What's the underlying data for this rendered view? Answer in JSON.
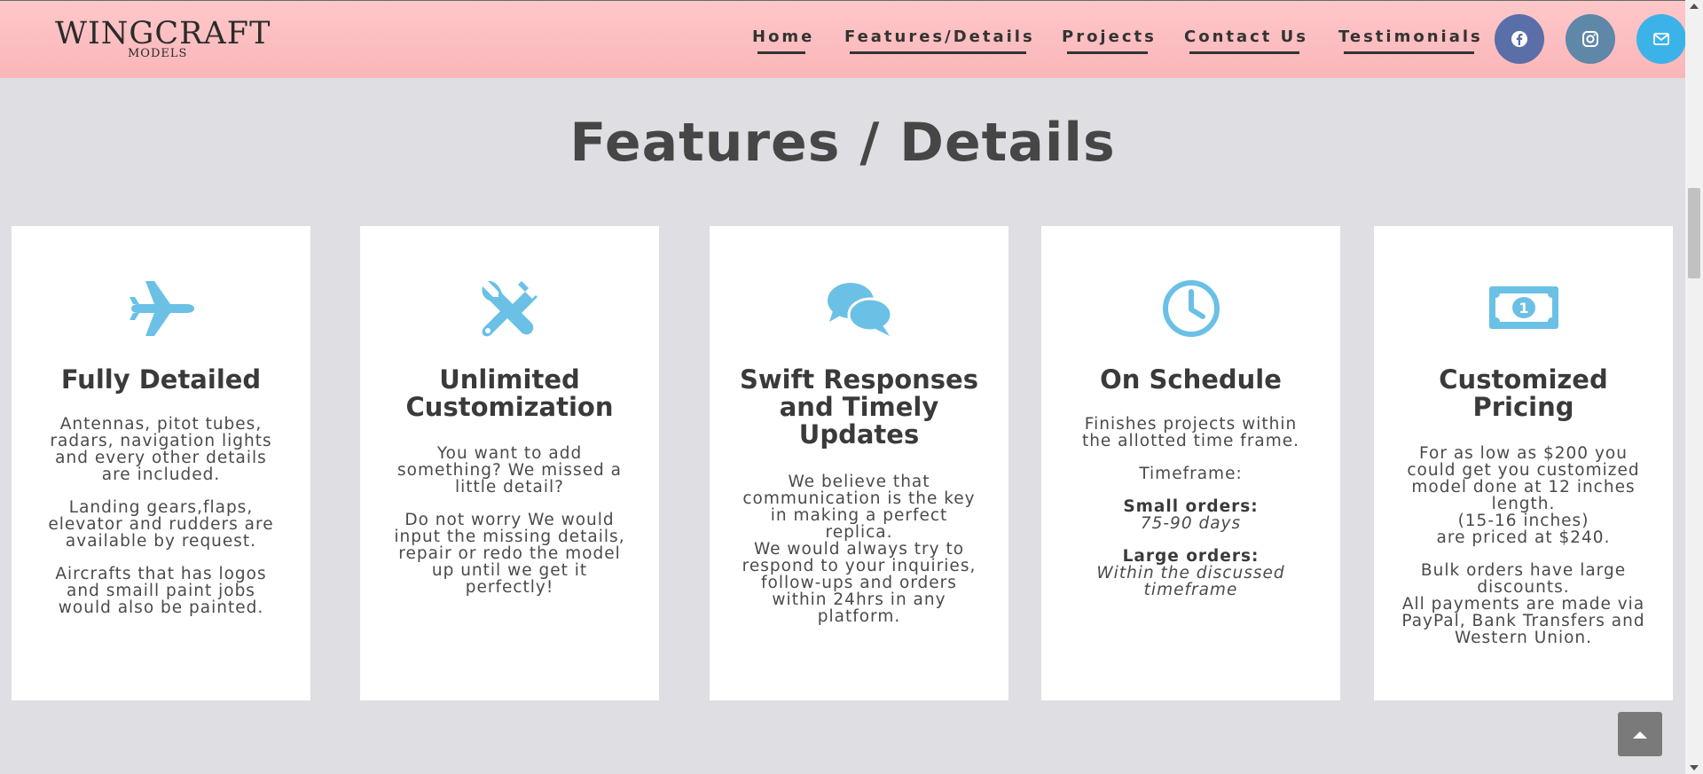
{
  "header": {
    "logo_main": "WINGCRAFT",
    "logo_sub": "MODELS",
    "nav": [
      {
        "label": "Home"
      },
      {
        "label": "Features/Details"
      },
      {
        "label": "Projects"
      },
      {
        "label": "Contact Us"
      },
      {
        "label": "Testimonials"
      }
    ],
    "social": [
      {
        "icon": "facebook-icon",
        "color": "#5a6ea8"
      },
      {
        "icon": "instagram-icon",
        "color": "#5f87a8"
      },
      {
        "icon": "mail-icon",
        "color": "#3bb3e8"
      }
    ]
  },
  "main": {
    "title": "Features / Details",
    "accent_color": "#6bc0e6",
    "cards": [
      {
        "icon": "airplane-icon",
        "title": "Fully Detailed",
        "p1": "Antennas, pitot tubes, radars, navigation lights and every other details are included.",
        "p2": "Landing gears,flaps, elevator and rudders are available by request.",
        "p3": "Aircrafts that has logos and smaill paint jobs would also be painted."
      },
      {
        "icon": "tools-icon",
        "title": "Unlimited Customization",
        "p1": "You want to add something? We missed a little detail?",
        "p2": "Do not worry We would input the missing details, repair or redo the model up until we get it perfectly!"
      },
      {
        "icon": "chat-icon",
        "title": "Swift Responses and Timely Updates",
        "p1": "We believe that communication is the key in making a perfect replica.",
        "p2": "We would always try to respond to your inquiries, follow-ups and orders within 24hrs in any platform."
      },
      {
        "icon": "clock-icon",
        "title": "On Schedule",
        "p1": "Finishes projects within the allotted time frame.",
        "p2": "Timeframe:",
        "small_label": "Small orders:",
        "small_value": "75-90 days",
        "large_label": "Large orders:",
        "large_value": "Within the discussed timeframe"
      },
      {
        "icon": "money-icon",
        "title": "Customized Pricing",
        "p1": "For as low as $200 you could get you customized model done at 12 inches length.",
        "p1b": "(15-16 inches)",
        "p1c": "are priced at $240.",
        "p2": "Bulk orders have large discounts.",
        "p2b": "All payments are made via PayPal, Bank Transfers and Western Union."
      }
    ]
  },
  "back_to_top": {
    "icon": "chevron-up-icon"
  }
}
